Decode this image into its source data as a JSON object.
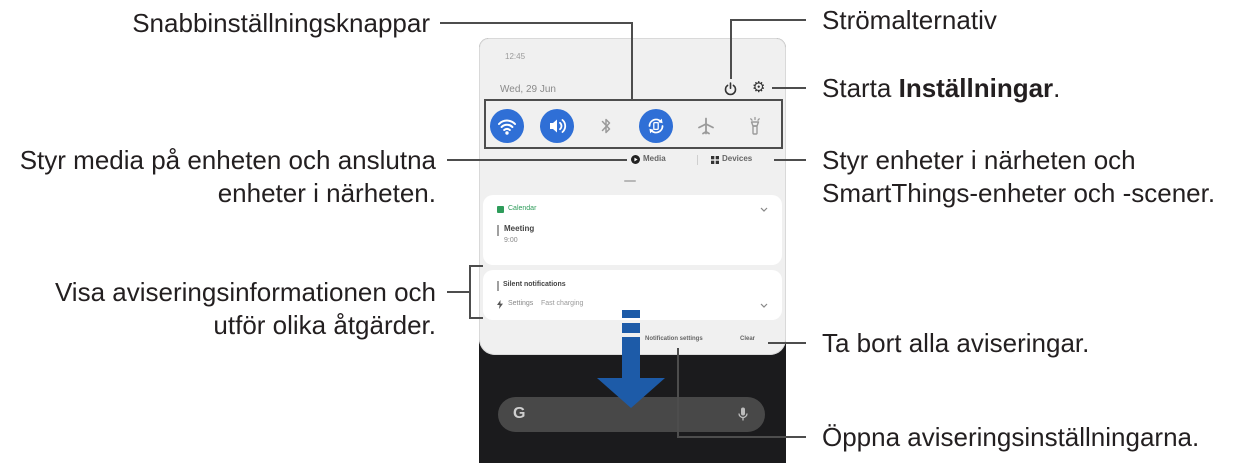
{
  "phone": {
    "status_time": "12:45",
    "date": "Wed, 29 Jun",
    "header_icons": [
      "power-icon",
      "gear-icon"
    ],
    "quick_settings": [
      {
        "icon": "wifi-icon",
        "active": true
      },
      {
        "icon": "sound-icon",
        "active": true
      },
      {
        "icon": "bluetooth-icon",
        "active": false
      },
      {
        "icon": "auto-rotate-icon",
        "active": true
      },
      {
        "icon": "airplane-mode-icon",
        "active": false
      },
      {
        "icon": "flashlight-icon",
        "active": false
      }
    ],
    "media_label": "Media",
    "devices_label": "Devices",
    "notifications": {
      "calendar": {
        "app": "Calendar",
        "title": "Meeting",
        "detail": "9:00"
      },
      "silent": {
        "header": "Silent notifications",
        "app": "Settings",
        "text": "Fast charging"
      }
    },
    "notification_settings_label": "Notification settings",
    "clear_label": "Clear",
    "search_bar": {
      "logo": "G",
      "icon": "mic-icon"
    }
  },
  "callouts": {
    "quick_settings": "Snabbinställningsknappar",
    "media": [
      "Styr media på enheten och anslutna",
      "enheter i närheten."
    ],
    "notifications": [
      "Visa aviseringsinformationen och",
      "utför olika åtgärder."
    ],
    "power": "Strömalternativ",
    "settings": {
      "prefix": "Starta ",
      "bold": "Inställningar",
      "suffix": "."
    },
    "devices": [
      "Styr enheter i närheten och",
      "SmartThings-enheter och -scener."
    ],
    "clear": "Ta bort alla aviseringar.",
    "notification_settings": "Öppna aviseringsinställningarna."
  },
  "colors": {
    "accent": "#2f6fd6",
    "arrow": "#1d5ba8",
    "calendar": "#2e9c5a",
    "panel": "#f0f0f0",
    "home_screen": "#1b1b1d"
  }
}
